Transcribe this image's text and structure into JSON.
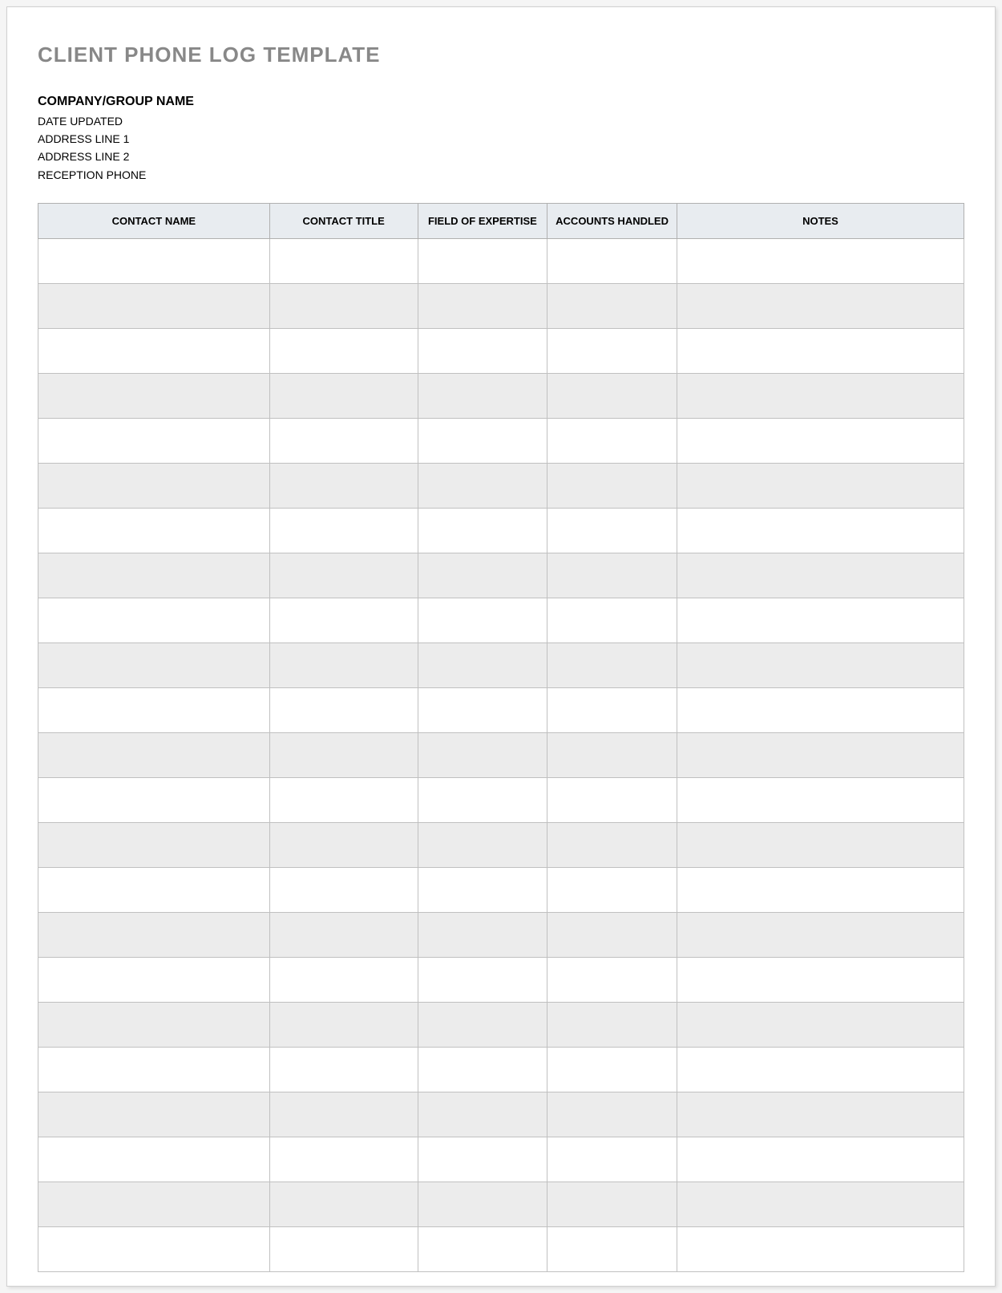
{
  "title": "CLIENT PHONE LOG TEMPLATE",
  "company": {
    "name_label": "COMPANY/GROUP NAME",
    "date_updated_label": "DATE UPDATED",
    "address_line_1_label": "ADDRESS LINE 1",
    "address_line_2_label": "ADDRESS LINE 2",
    "reception_phone_label": "RECEPTION PHONE"
  },
  "table": {
    "headers": {
      "contact_name": "CONTACT NAME",
      "contact_title": "CONTACT TITLE",
      "field_of_expertise": "FIELD OF EXPERTISE",
      "accounts_handled": "ACCOUNTS HANDLED",
      "notes": "NOTES"
    },
    "rows": [
      {
        "contact_name": "",
        "contact_title": "",
        "field_of_expertise": "",
        "accounts_handled": "",
        "notes": ""
      },
      {
        "contact_name": "",
        "contact_title": "",
        "field_of_expertise": "",
        "accounts_handled": "",
        "notes": ""
      },
      {
        "contact_name": "",
        "contact_title": "",
        "field_of_expertise": "",
        "accounts_handled": "",
        "notes": ""
      },
      {
        "contact_name": "",
        "contact_title": "",
        "field_of_expertise": "",
        "accounts_handled": "",
        "notes": ""
      },
      {
        "contact_name": "",
        "contact_title": "",
        "field_of_expertise": "",
        "accounts_handled": "",
        "notes": ""
      },
      {
        "contact_name": "",
        "contact_title": "",
        "field_of_expertise": "",
        "accounts_handled": "",
        "notes": ""
      },
      {
        "contact_name": "",
        "contact_title": "",
        "field_of_expertise": "",
        "accounts_handled": "",
        "notes": ""
      },
      {
        "contact_name": "",
        "contact_title": "",
        "field_of_expertise": "",
        "accounts_handled": "",
        "notes": ""
      },
      {
        "contact_name": "",
        "contact_title": "",
        "field_of_expertise": "",
        "accounts_handled": "",
        "notes": ""
      },
      {
        "contact_name": "",
        "contact_title": "",
        "field_of_expertise": "",
        "accounts_handled": "",
        "notes": ""
      },
      {
        "contact_name": "",
        "contact_title": "",
        "field_of_expertise": "",
        "accounts_handled": "",
        "notes": ""
      },
      {
        "contact_name": "",
        "contact_title": "",
        "field_of_expertise": "",
        "accounts_handled": "",
        "notes": ""
      },
      {
        "contact_name": "",
        "contact_title": "",
        "field_of_expertise": "",
        "accounts_handled": "",
        "notes": ""
      },
      {
        "contact_name": "",
        "contact_title": "",
        "field_of_expertise": "",
        "accounts_handled": "",
        "notes": ""
      },
      {
        "contact_name": "",
        "contact_title": "",
        "field_of_expertise": "",
        "accounts_handled": "",
        "notes": ""
      },
      {
        "contact_name": "",
        "contact_title": "",
        "field_of_expertise": "",
        "accounts_handled": "",
        "notes": ""
      },
      {
        "contact_name": "",
        "contact_title": "",
        "field_of_expertise": "",
        "accounts_handled": "",
        "notes": ""
      },
      {
        "contact_name": "",
        "contact_title": "",
        "field_of_expertise": "",
        "accounts_handled": "",
        "notes": ""
      },
      {
        "contact_name": "",
        "contact_title": "",
        "field_of_expertise": "",
        "accounts_handled": "",
        "notes": ""
      },
      {
        "contact_name": "",
        "contact_title": "",
        "field_of_expertise": "",
        "accounts_handled": "",
        "notes": ""
      },
      {
        "contact_name": "",
        "contact_title": "",
        "field_of_expertise": "",
        "accounts_handled": "",
        "notes": ""
      },
      {
        "contact_name": "",
        "contact_title": "",
        "field_of_expertise": "",
        "accounts_handled": "",
        "notes": ""
      },
      {
        "contact_name": "",
        "contact_title": "",
        "field_of_expertise": "",
        "accounts_handled": "",
        "notes": ""
      }
    ]
  }
}
